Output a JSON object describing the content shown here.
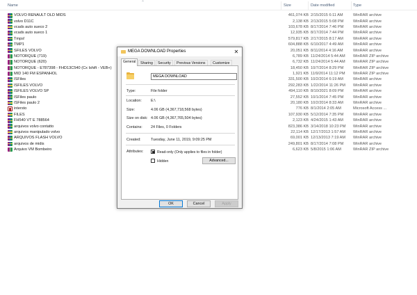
{
  "file_list": {
    "columns": {
      "name": "Name",
      "size": "Size",
      "date": "Date modified",
      "type": "Type"
    },
    "rows": [
      {
        "name": "VOLVO RENAULT OLD MIDS",
        "size": "461,074 KB",
        "date": "2/15/2015 6:11 AM",
        "type": "WinRAR archive",
        "icon": "winrar-archive-icon"
      },
      {
        "name": "volvo D11C",
        "size": "2,138 KB",
        "date": "2/13/2015 5:08 PM",
        "type": "WinRAR archive",
        "icon": "winrar-archive-icon"
      },
      {
        "name": "vcads auto sueco 2",
        "size": "103,678 KB",
        "date": "8/17/2014 7:46 PM",
        "type": "WinRAR archive",
        "icon": "winrar-archive-icon"
      },
      {
        "name": "vcads auto sueco 1",
        "size": "12,935 KB",
        "date": "8/17/2014 7:44 PM",
        "type": "WinRAR archive",
        "icon": "winrar-archive-icon"
      },
      {
        "name": "Tmps!",
        "size": "579,817 KB",
        "date": "2/17/2015 8:17 AM",
        "type": "WinRAR archive",
        "icon": "winrar-archive-icon"
      },
      {
        "name": "TMP1",
        "size": "604,888 KB",
        "date": "6/10/2017 4:49 AM",
        "type": "WinRAR archive",
        "icon": "winrar-archive-icon"
      },
      {
        "name": "SFILES VOLVO",
        "size": "20,051 KB",
        "date": "8/11/2014 4:16 AM",
        "type": "WinRAR archive",
        "icon": "winrar-archive-icon"
      },
      {
        "name": "NOTORQUE (719)",
        "size": "6,789 KB",
        "date": "11/24/2014 5:44 AM",
        "type": "WinRAR ZIP archive",
        "icon": "winrar-zip-icon"
      },
      {
        "name": "NOTORQUE (620)",
        "size": "6,732 KB",
        "date": "11/24/2014 5:44 AM",
        "type": "WinRAR ZIP archive",
        "icon": "winrar-zip-icon"
      },
      {
        "name": "NOTORQUE - E787398 - FHD13C540 (Cx Ishift - VEB+)",
        "size": "18,450 KB",
        "date": "10/7/2014 8:29 PM",
        "type": "WinRAR ZIP archive",
        "icon": "winrar-zip-icon"
      },
      {
        "name": "MID 140 FM ESPANHOL",
        "size": "1,921 KB",
        "date": "11/9/2014 11:12 PM",
        "type": "WinRAR ZIP archive",
        "icon": "winrar-zip-icon"
      },
      {
        "name": "ISFiles",
        "size": "331,500 KB",
        "date": "10/2/2014 6:19 AM",
        "type": "WinRAR archive",
        "icon": "winrar-archive-icon"
      },
      {
        "name": "ISFILES VOLVO",
        "size": "292,283 KB",
        "date": "1/22/2014 11:26 PM",
        "type": "WinRAR archive",
        "icon": "winrar-archive-icon"
      },
      {
        "name": "ISFILES VOLVO SP",
        "size": "494,110 KB",
        "date": "8/10/2021 8:09 PM",
        "type": "WinRAR archive",
        "icon": "winrar-archive-icon"
      },
      {
        "name": "ISFiles paulo",
        "size": "27,552 KB",
        "date": "10/1/2014 7:45 PM",
        "type": "WinRAR archive",
        "icon": "winrar-archive-icon"
      },
      {
        "name": "ISFiles paulo 2",
        "size": "20,180 KB",
        "date": "10/2/2014 8:33 AM",
        "type": "WinRAR archive",
        "icon": "winrar-archive-icon"
      },
      {
        "name": "intersto",
        "size": "776 KB",
        "date": "8/1/2014 2:05 AM",
        "type": "Microsoft Access ...",
        "icon": "access-database-icon"
      },
      {
        "name": "FILES",
        "size": "107,930 KB",
        "date": "5/12/2014 7:35 PM",
        "type": "WinRAR archive",
        "icon": "winrar-archive-icon"
      },
      {
        "name": "FH540 VT E 788564",
        "size": "2,123 KB",
        "date": "4/24/2015 1:43 AM",
        "type": "WinRAR archive",
        "icon": "winrar-archive-icon"
      },
      {
        "name": "arquivos volvo contatto",
        "size": "823,386 KB",
        "date": "3/14/2018 10:23 PM",
        "type": "WinRAR archive",
        "icon": "winrar-archive-icon"
      },
      {
        "name": "arquivos manipulado volvo",
        "size": "22,114 KB",
        "date": "12/17/2013 1:57 AM",
        "type": "WinRAR archive",
        "icon": "winrar-archive-icon"
      },
      {
        "name": "ARQUIVOS FLASH VOLVO",
        "size": "69,001 KB",
        "date": "12/13/2013 7:19 AM",
        "type": "WinRAR archive",
        "icon": "winrar-archive-icon"
      },
      {
        "name": "arquivos de midis",
        "size": "249,801 KB",
        "date": "8/17/2014 7:08 PM",
        "type": "WinRAR archive",
        "icon": "winrar-archive-icon"
      },
      {
        "name": "Arquivo VM Bombeiro",
        "size": "6,623 KB",
        "date": "5/8/2015 1:06 AM",
        "type": "WinRAR ZIP archive",
        "icon": "winrar-zip-icon"
      }
    ]
  },
  "dialog": {
    "title": "MEGA DOWNLOAD Properties",
    "close_glyph": "✕",
    "tabs": [
      "General",
      "Sharing",
      "Security",
      "Previous Versions",
      "Customize"
    ],
    "active_tab": "General",
    "folder_name": "MEGA DOWNLOAD",
    "properties": {
      "type_label": "Type:",
      "type_value": "File folder",
      "location_label": "Location:",
      "location_value": "E:\\",
      "size_label": "Size:",
      "size_value": "4.06 GB (4,367,718,568 bytes)",
      "size_on_disk_label": "Size on disk:",
      "size_on_disk_value": "4.06 GB (4,367,765,504 bytes)",
      "contains_label": "Contains:",
      "contains_value": "24 Files, 0 Folders",
      "created_label": "Created:",
      "created_value": "Tuesday, June 11, 2019, 9:09:25 PM",
      "attributes_label": "Attributes:"
    },
    "attributes": {
      "readonly_label": "Read-only (Only applies to files in folder)",
      "readonly_state": "indeterminate",
      "hidden_label": "Hidden",
      "hidden_checked": false,
      "advanced_label": "Advanced..."
    },
    "buttons": {
      "ok": "OK",
      "cancel": "Cancel",
      "apply": "Apply"
    }
  }
}
